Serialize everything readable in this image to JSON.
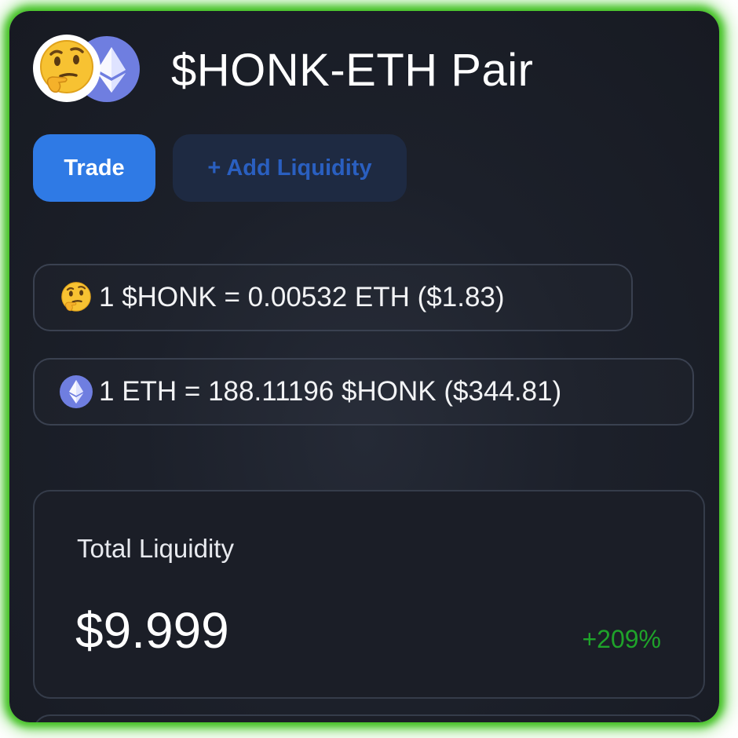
{
  "header": {
    "title": "$HONK-ETH Pair",
    "token_icons": [
      "thinking-face-icon",
      "ethereum-icon"
    ]
  },
  "tabs": [
    {
      "label": "Trade",
      "active": true
    },
    {
      "label": "+ Add Liquidity",
      "active": false
    }
  ],
  "rates": [
    {
      "icon": "thinking-face-icon",
      "text": "1 $HONK = 0.00532 ETH ($1.83)"
    },
    {
      "icon": "ethereum-icon",
      "text": "1 ETH = 188.11196 $HONK ($344.81)"
    }
  ],
  "liquidity": {
    "label": "Total Liquidity",
    "value": "$9.999",
    "change": "+209%"
  },
  "colors": {
    "frame_glow": "#3fbf1f",
    "accent_blue": "#2f7ae5",
    "eth_purple": "#6f7ee0",
    "positive_green": "#1fa32a"
  }
}
